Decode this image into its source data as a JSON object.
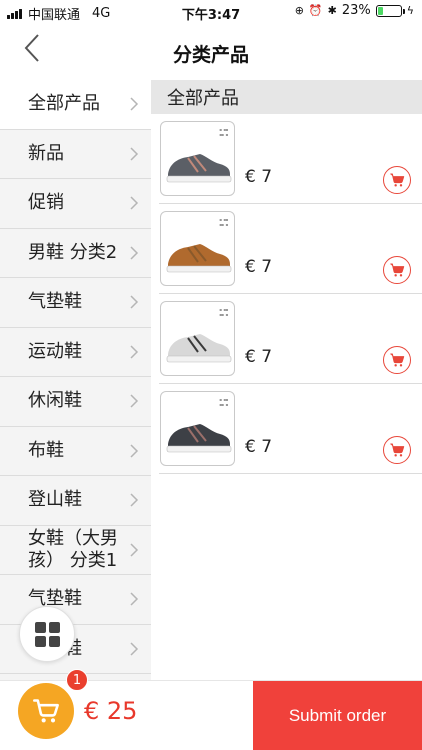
{
  "status_bar": {
    "carrier": "中国联通",
    "network": "4G",
    "time": "下午3:47",
    "battery": "23%",
    "battery_level": 0.23
  },
  "nav": {
    "title": "分类产品"
  },
  "categories": [
    {
      "label": "全部产品"
    },
    {
      "label": "新品"
    },
    {
      "label": "促销"
    },
    {
      "label": "男鞋 分类2"
    },
    {
      "label": "气垫鞋"
    },
    {
      "label": "运动鞋"
    },
    {
      "label": "休闲鞋"
    },
    {
      "label": "布鞋"
    },
    {
      "label": "登山鞋"
    },
    {
      "label": "女鞋（大男孩） 分类1"
    },
    {
      "label": "气垫鞋"
    },
    {
      "label": "运动鞋"
    }
  ],
  "content": {
    "section_title": "全部产品",
    "products": [
      {
        "price": "€ 7",
        "shoe_color": "#5b5f66",
        "accent": "#c0897a"
      },
      {
        "price": "€ 7",
        "shoe_color": "#b06a2e",
        "accent": "#8a5a2b"
      },
      {
        "price": "€ 7",
        "shoe_color": "#d8d8d8",
        "accent": "#3a3a3a"
      },
      {
        "price": "€ 7",
        "shoe_color": "#3d4046",
        "accent": "#9a6f6a"
      }
    ]
  },
  "bottom": {
    "cart_count": "1",
    "total": "€ 25",
    "submit_label": "Submit order"
  },
  "colors": {
    "accent_red": "#f0413b",
    "cart_orange": "#f5a623"
  },
  "icons": {
    "back": "chevron-left-icon",
    "category_chevron": "chevron-right-icon",
    "add_to_cart": "cart-icon",
    "grid": "grid-icon"
  }
}
